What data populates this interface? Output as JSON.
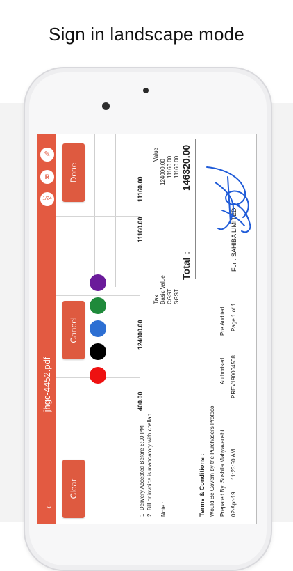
{
  "headline": "Sign in landscape mode",
  "app": {
    "file_name": "jhgc-4452.pdf",
    "back_icon": "back-arrow-icon",
    "page_indicator": "1/24",
    "rotate_label": "R",
    "pen_icon": "pencil-icon"
  },
  "buttons": {
    "done": "Done",
    "cancel": "Cancel",
    "clear": "Clear"
  },
  "colors": {
    "accent": "#e35a41",
    "swatches": [
      "#6a1b9a",
      "#1f8a3b",
      "#2d6fd3",
      "#000000",
      "#ee1111"
    ],
    "signature": "#1f5bd8"
  },
  "document": {
    "amounts_row": [
      "400.00",
      "124000.00",
      "11160.00",
      "11160.00"
    ],
    "notes": [
      "1. Delivery Accepted Before 6:00 PM",
      "2. Bill or invoice is mandatory with challan."
    ],
    "note_label": "Note :",
    "tax_label": "Tax",
    "tax_items": [
      "Basic Value",
      "CGST",
      "SGST"
    ],
    "tax_values": [
      "124000.00",
      "11160.00",
      "11160.00"
    ],
    "value_header": "Value",
    "total_label": "Total :",
    "total_value": "146320.00",
    "terms_title": "Terms & Conditions :",
    "terms_text": "Would Be Govern by the Purchasers Protoco",
    "prepared_by": "Prepared By:  Sushila Mahyavanshi",
    "authorised": "Authorised",
    "pre_audited": "Pre Audited",
    "date": "02-Apr-19",
    "time": "11:23:50 AM",
    "ref": "PREV190004508",
    "page": "Page 1 of 1",
    "for_company": "For :  SAHIBA LIMITED"
  }
}
